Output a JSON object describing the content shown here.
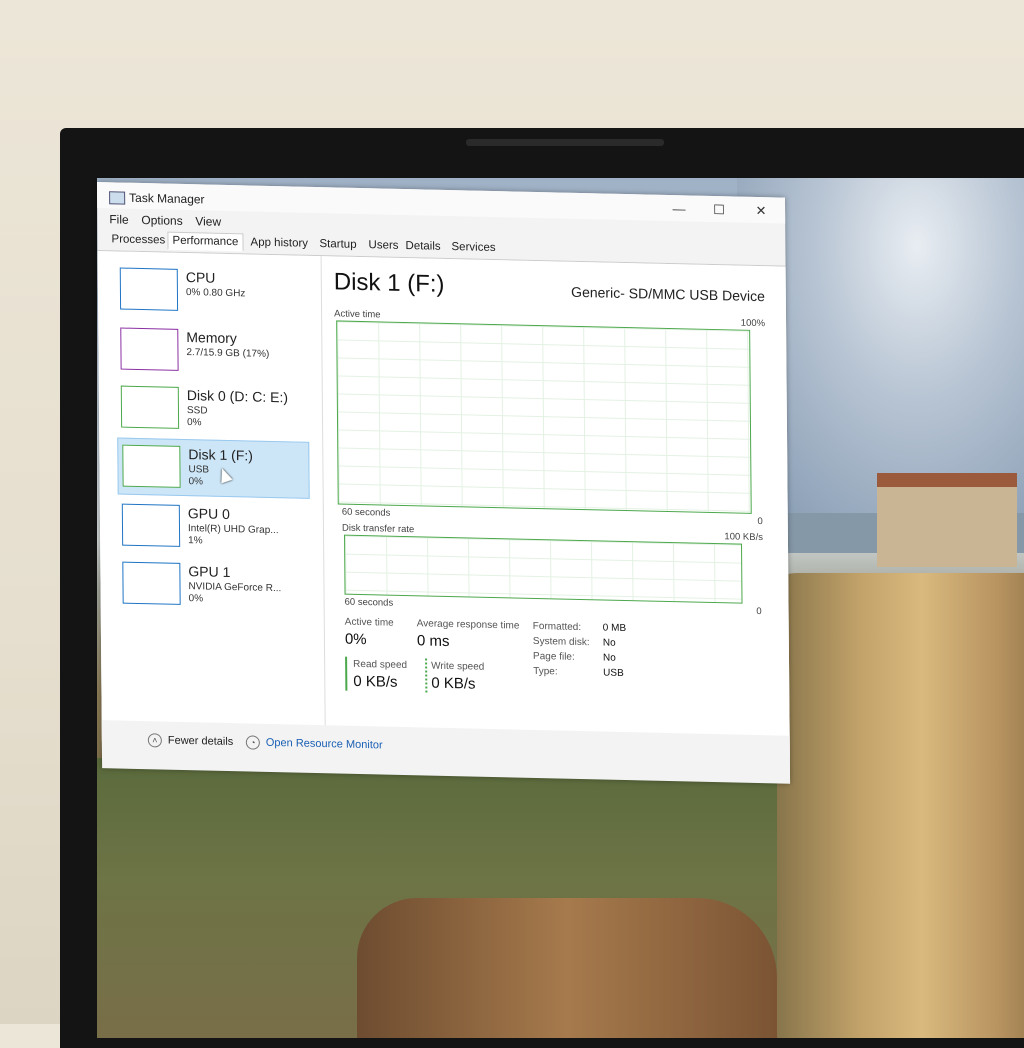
{
  "window": {
    "title": "Task Manager",
    "controls": {
      "minimize": "—",
      "maximize": "☐",
      "close": "✕"
    }
  },
  "menu": [
    "File",
    "Options",
    "View"
  ],
  "tabs": [
    {
      "label": "Processes",
      "active": false
    },
    {
      "label": "Performance",
      "active": true
    },
    {
      "label": "App history",
      "active": false
    },
    {
      "label": "Startup",
      "active": false
    },
    {
      "label": "Users",
      "active": false
    },
    {
      "label": "Details",
      "active": false
    },
    {
      "label": "Services",
      "active": false
    }
  ],
  "devices": [
    {
      "name": "CPU",
      "sub1": "0% 0.80 GHz",
      "sub2": "",
      "color": "#1f74c4",
      "selected": false
    },
    {
      "name": "Memory",
      "sub1": "2.7/15.9 GB (17%)",
      "sub2": "",
      "color": "#8b2fa3",
      "selected": false
    },
    {
      "name": "Disk 0 (D: C: E:)",
      "sub1": "SSD",
      "sub2": "0%",
      "color": "#4ca84c",
      "selected": false
    },
    {
      "name": "Disk 1 (F:)",
      "sub1": "USB",
      "sub2": "0%",
      "color": "#4ca84c",
      "selected": true
    },
    {
      "name": "GPU 0",
      "sub1": "Intel(R) UHD Grap...",
      "sub2": "1%",
      "color": "#1f74c4",
      "selected": false
    },
    {
      "name": "GPU 1",
      "sub1": "NVIDIA GeForce R...",
      "sub2": "0%",
      "color": "#1f74c4",
      "selected": false
    }
  ],
  "detail": {
    "title": "Disk 1 (F:)",
    "model": "Generic- SD/MMC USB Device",
    "graph1": {
      "label": "Active time",
      "max": "100%",
      "time": "60 seconds",
      "min": "0"
    },
    "graph2": {
      "label": "Disk transfer rate",
      "max": "100 KB/s",
      "time": "60 seconds",
      "min": "0"
    },
    "stats": {
      "active_time_label": "Active time",
      "active_time": "0%",
      "avg_resp_label": "Average response time",
      "avg_resp": "0 ms",
      "read_label": "Read speed",
      "read": "0 KB/s",
      "write_label": "Write speed",
      "write": "0 KB/s"
    },
    "props": [
      {
        "k": "Formatted:",
        "v": "0 MB"
      },
      {
        "k": "System disk:",
        "v": "No"
      },
      {
        "k": "Page file:",
        "v": "No"
      },
      {
        "k": "Type:",
        "v": "USB"
      }
    ]
  },
  "footer": {
    "fewer": "Fewer details",
    "monitor": "Open Resource Monitor"
  }
}
